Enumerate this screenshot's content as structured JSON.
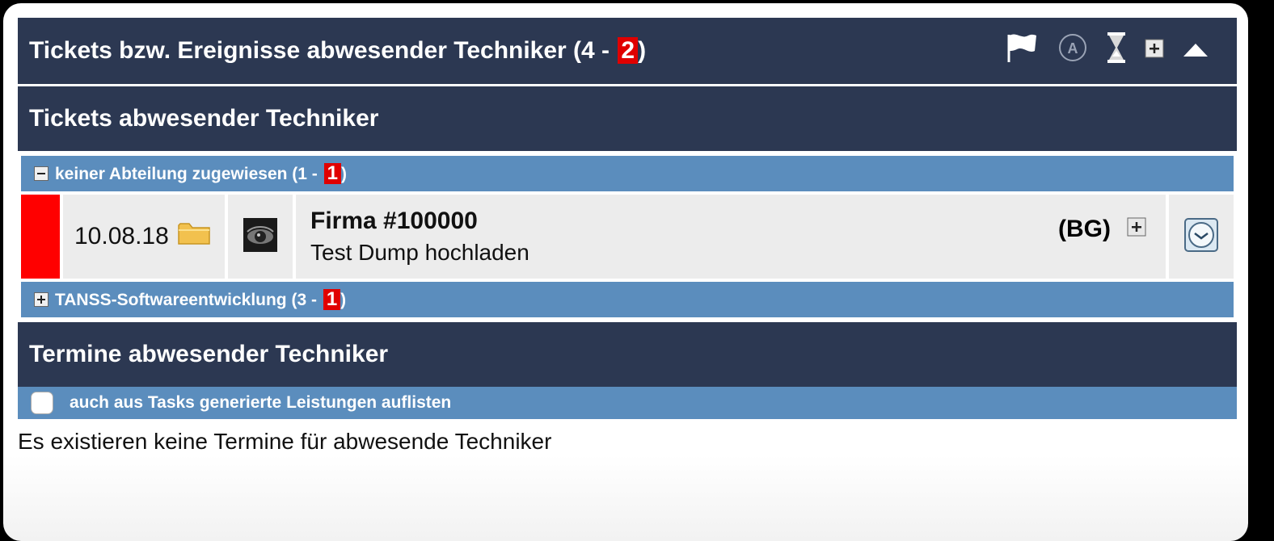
{
  "header": {
    "title": "Tickets bzw. Ereignisse abwesender Techniker (4 - ",
    "badge": "2",
    "title_end": ")",
    "icons": [
      "flag-icon",
      "a-circle-icon",
      "hourglass-icon",
      "expand-plus-icon",
      "collapse-up-icon"
    ]
  },
  "tickets_section": {
    "title": "Tickets abwesender Techniker",
    "groups": [
      {
        "label": "keiner Abteilung zugewiesen (1 - ",
        "badge": "1",
        "label_end": ")",
        "expanded": true,
        "tickets": [
          {
            "date": "10.08.18",
            "company": "Firma #100000",
            "description": "Test Dump hochladen",
            "country": "(BG)",
            "priority_color": "#ff0000"
          }
        ]
      },
      {
        "label": "TANSS-Softwareentwicklung (3 - ",
        "badge": "1",
        "label_end": ")",
        "expanded": false
      }
    ]
  },
  "appointments_section": {
    "title": "Termine abwesender Techniker",
    "checkbox_label": "auch aus Tasks generierte Leistungen auflisten",
    "checkbox_checked": false,
    "empty_text": "Es existieren keine Termine für abwesende Techniker"
  },
  "colors": {
    "header_bg": "#2c3852",
    "group_bg": "#5b8dbd",
    "badge_bg": "#e00000"
  }
}
